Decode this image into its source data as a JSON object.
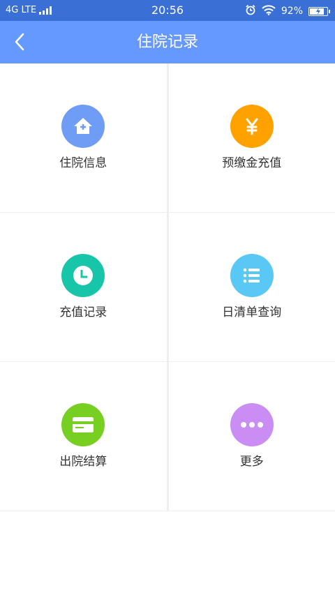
{
  "status_bar": {
    "network": "4G LTE",
    "time": "20:56",
    "battery": "92%",
    "battery_level": 0.92
  },
  "header": {
    "title": "住院记录"
  },
  "menu": [
    {
      "label": "住院信息",
      "icon": "hospital-house-icon",
      "color": "#6f9cf5"
    },
    {
      "label": "预缴金充值",
      "icon": "yen-icon",
      "color": "#ffa200"
    },
    {
      "label": "充值记录",
      "icon": "clock-icon",
      "color": "#17c5a8"
    },
    {
      "label": "日清单查询",
      "icon": "list-icon",
      "color": "#5ac8f5"
    },
    {
      "label": "出院结算",
      "icon": "card-icon",
      "color": "#77cf22"
    },
    {
      "label": "更多",
      "icon": "more-dots-icon",
      "color": "#c98df3"
    }
  ]
}
